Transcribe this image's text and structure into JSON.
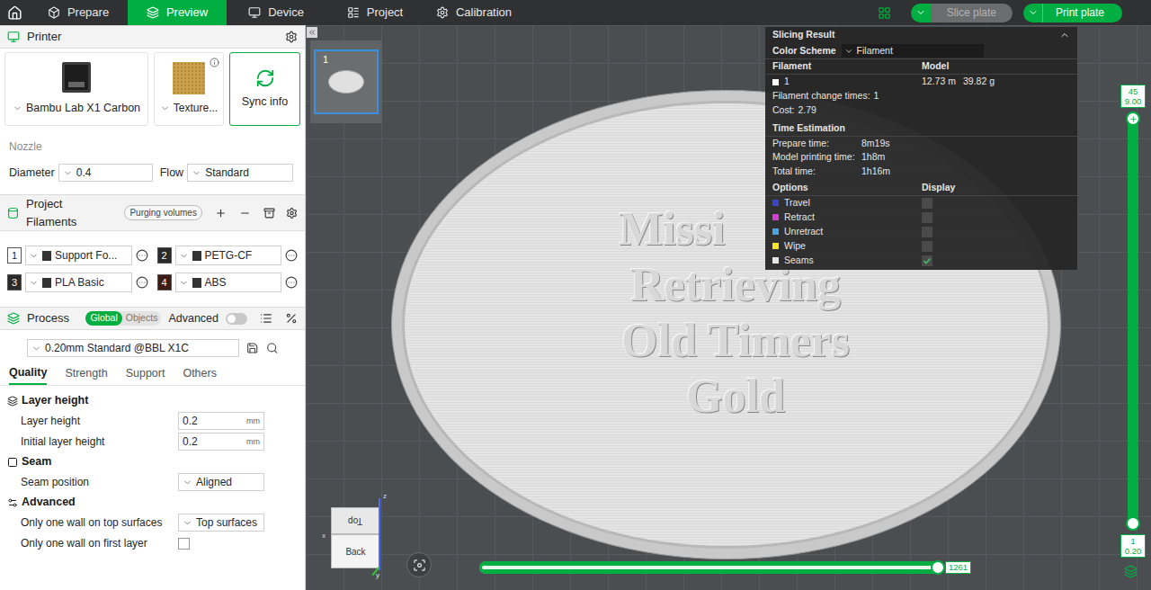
{
  "toolbar": {
    "tabs": [
      {
        "label": "Prepare",
        "selected": false
      },
      {
        "label": "Preview",
        "selected": true
      },
      {
        "label": "Device",
        "selected": false
      },
      {
        "label": "Project",
        "selected": false
      },
      {
        "label": "Calibration",
        "selected": false
      }
    ],
    "slice_button": {
      "label": "Slice plate",
      "disabled": true
    },
    "print_button": {
      "label": "Print plate",
      "disabled": false
    }
  },
  "printer": {
    "title": "Printer",
    "model": "Bambu Lab X1 Carbon",
    "plate_type": "Texture...",
    "sync_label": "Sync info"
  },
  "nozzle": {
    "title": "Nozzle",
    "diameter_label": "Diameter",
    "diameter": "0.4",
    "flow_label": "Flow",
    "flow": "Standard"
  },
  "filaments": {
    "title": "Project Filaments",
    "purge_label": "Purging volumes",
    "items": [
      {
        "index": "1",
        "name": "Support Fo...",
        "color": "#ffffff"
      },
      {
        "index": "2",
        "name": "PETG-CF",
        "color": "#2a2a2a"
      },
      {
        "index": "3",
        "name": "PLA Basic",
        "color": "#2a2a2a"
      },
      {
        "index": "4",
        "name": "ABS",
        "color": "#3d1c14"
      }
    ]
  },
  "process": {
    "title": "Process",
    "scope": [
      {
        "label": "Global",
        "selected": true
      },
      {
        "label": "Objects",
        "selected": false
      }
    ],
    "advanced_label": "Advanced",
    "advanced": false,
    "preset": "0.20mm Standard @BBL X1C",
    "tabs": [
      {
        "label": "Quality",
        "selected": true
      },
      {
        "label": "Strength",
        "selected": false
      },
      {
        "label": "Support",
        "selected": false
      },
      {
        "label": "Others",
        "selected": false
      }
    ],
    "sections": [
      {
        "title": "Layer height",
        "rows": [
          {
            "kind": "input",
            "label": "Layer height",
            "value": "0.2",
            "unit": "mm"
          },
          {
            "kind": "input",
            "label": "Initial layer height",
            "value": "0.2",
            "unit": "mm"
          }
        ]
      },
      {
        "title": "Seam",
        "rows": [
          {
            "kind": "select",
            "label": "Seam position",
            "value": "Aligned"
          }
        ]
      },
      {
        "title": "Advanced",
        "rows": [
          {
            "kind": "select",
            "label": "Only one wall on top surfaces",
            "value": "Top surfaces"
          },
          {
            "kind": "checkbox",
            "label": "Only one wall on first layer",
            "checked": false
          }
        ]
      }
    ]
  },
  "plates": [
    {
      "number": "1",
      "selected": true
    }
  ],
  "model_text": [
    "Missi",
    "Retrieving",
    "Old Timers",
    "Gold"
  ],
  "slicing_result": {
    "title": "Slicing Result",
    "color_scheme_label": "Color Scheme",
    "color_scheme": "Filament",
    "columns": [
      "Filament",
      "Model"
    ],
    "filaments": [
      {
        "name": "1",
        "length": "12.73 m",
        "weight": "39.82 g",
        "color": "#ffffff"
      }
    ],
    "stats": [
      {
        "label": "Filament change times:",
        "value": "1"
      },
      {
        "label": "Cost:",
        "value": "2.79"
      }
    ],
    "time_title": "Time Estimation",
    "times": [
      {
        "label": "Prepare time:",
        "value": "8m19s"
      },
      {
        "label": "Model printing time:",
        "value": "1h8m"
      },
      {
        "label": "Total time:",
        "value": "1h16m"
      }
    ],
    "option_columns": [
      "Options",
      "Display"
    ],
    "options": [
      {
        "label": "Travel",
        "color": "#3b46c4",
        "checked": false
      },
      {
        "label": "Retract",
        "color": "#d23fd2",
        "checked": false
      },
      {
        "label": "Unretract",
        "color": "#4aa3df",
        "checked": false
      },
      {
        "label": "Wipe",
        "color": "#f5e52a",
        "checked": false
      },
      {
        "label": "Seams",
        "color": "#e6e6e6",
        "checked": true
      }
    ]
  },
  "layer_slider": {
    "top_layer": "45",
    "top_height": "9.00",
    "bottom_layer": "1",
    "bottom_height": "0.20",
    "level": 1
  },
  "move_slider": {
    "value": "1261",
    "level": 1
  },
  "view_cube": {
    "top": "Top",
    "back": "Back",
    "axes": [
      "z",
      "y",
      "x"
    ]
  }
}
